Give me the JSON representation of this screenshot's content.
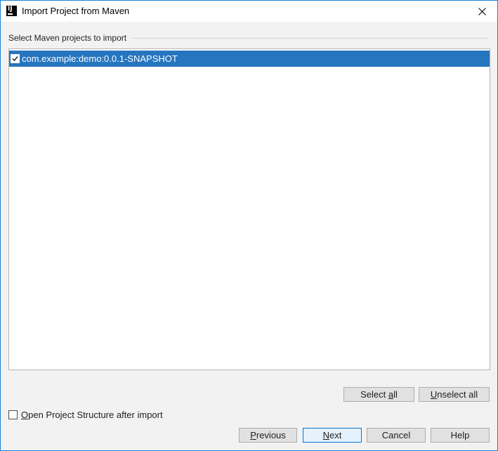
{
  "window": {
    "title": "Import Project from Maven",
    "accent_border": "#1883d7"
  },
  "icons": {
    "app": "intellij-idea-icon",
    "close": "close-icon",
    "check": "checkmark-icon"
  },
  "projects_group": {
    "label": "Select Maven projects to import",
    "items": [
      {
        "label": "com.example:demo:0.0.1-SNAPSHOT",
        "checked": true,
        "selected": true
      }
    ],
    "selection_color": "#2675bf"
  },
  "selection_buttons": {
    "select_all_prefix": "Select ",
    "select_all_mnemonic": "a",
    "select_all_suffix": "ll",
    "unselect_all_mnemonic": "U",
    "unselect_all_suffix": "nselect all"
  },
  "footer": {
    "open_structure_mnemonic": "O",
    "open_structure_suffix": "pen Project Structure after import",
    "open_structure_checked": false
  },
  "nav_buttons": {
    "previous_mnemonic": "P",
    "previous_suffix": "revious",
    "next_mnemonic": "N",
    "next_suffix": "ext",
    "cancel": "Cancel",
    "help": "Help"
  }
}
